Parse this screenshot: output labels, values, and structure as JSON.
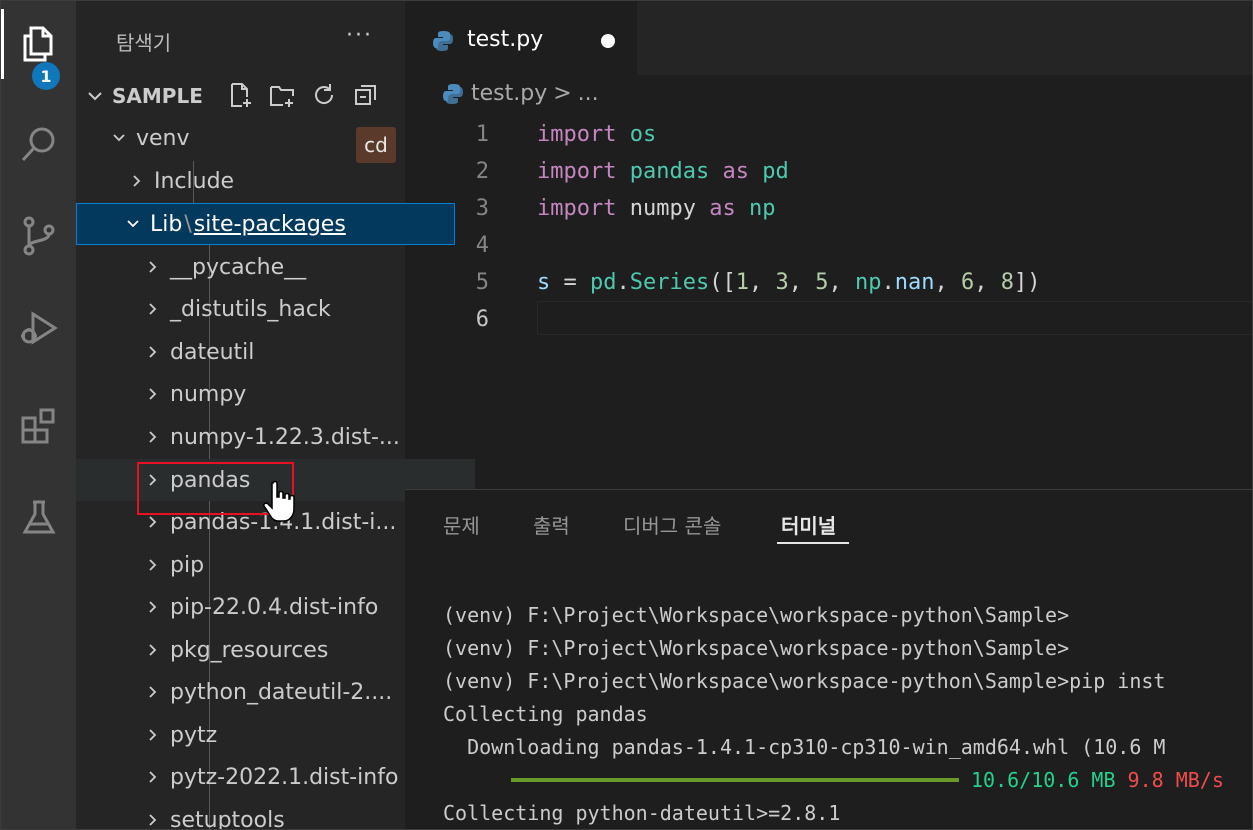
{
  "activity_bar": {
    "explorer_badge": "1",
    "icons": [
      "files-icon",
      "search-icon",
      "source-control-icon",
      "run-debug-icon",
      "extensions-icon",
      "testing-icon"
    ]
  },
  "sidebar": {
    "title": "탐색기",
    "more_label": "···",
    "section_label": "SAMPLE",
    "cd_badge": "cd",
    "tree": [
      {
        "label": "venv",
        "expanded": true
      },
      {
        "label": "Include",
        "expanded": false
      },
      {
        "label_a": "Lib",
        "separator": "\\",
        "label_b": "site-packages",
        "expanded": true
      },
      {
        "label": "__pycache__"
      },
      {
        "label": "_distutils_hack"
      },
      {
        "label": "dateutil"
      },
      {
        "label": "numpy"
      },
      {
        "label": "numpy-1.22.3.dist-..."
      },
      {
        "label": "pandas"
      },
      {
        "label": "pandas-1.4.1.dist-i..."
      },
      {
        "label": "pip"
      },
      {
        "label": "pip-22.0.4.dist-info"
      },
      {
        "label": "pkg_resources"
      },
      {
        "label": "python_dateutil-2...."
      },
      {
        "label": "pytz"
      },
      {
        "label": "pytz-2022.1.dist-info"
      },
      {
        "label": "setuptools"
      }
    ]
  },
  "editor": {
    "tab_label": "test.py",
    "breadcrumb_file": "test.py",
    "breadcrumb_sep": ">",
    "breadcrumb_more": "...",
    "line_numbers": [
      "1",
      "2",
      "3",
      "4",
      "5",
      "6"
    ],
    "code": {
      "l1_kw": "import",
      "l1_mod": "os",
      "l2_kw": "import",
      "l2_mod": "pandas",
      "l2_as": "as",
      "l2_alias": "pd",
      "l3_kw": "import",
      "l3_mod": "numpy",
      "l3_as": "as",
      "l3_alias": "np",
      "l5_var": "s",
      "l5_eq": " = ",
      "l5_obj": "pd",
      "l5_dot": ".",
      "l5_cls": "Series",
      "l5_open": "([",
      "l5_n1": "1",
      "l5_c1": ", ",
      "l5_n2": "3",
      "l5_c2": ", ",
      "l5_n3": "5",
      "l5_c3": ", ",
      "l5_np": "np",
      "l5_dot2": ".",
      "l5_nan": "nan",
      "l5_c4": ", ",
      "l5_n4": "6",
      "l5_c5": ", ",
      "l5_n5": "8",
      "l5_close": "])"
    }
  },
  "panel": {
    "tabs": [
      "문제",
      "출력",
      "디버그 콘솔",
      "터미널"
    ],
    "active_tab": "터미널",
    "terminal": {
      "line1": "(venv) F:\\Project\\Workspace\\workspace-python\\Sample>",
      "line2": "(venv) F:\\Project\\Workspace\\workspace-python\\Sample>",
      "line3": "(venv) F:\\Project\\Workspace\\workspace-python\\Sample>pip inst",
      "line4": "Collecting pandas",
      "line5": "  Downloading pandas-1.4.1-cp310-cp310-win_amd64.whl (10.6 M",
      "progress_size": "10.6/10.6 MB",
      "progress_speed": "9.8 MB/s",
      "progress_fraction": 1.0,
      "line7": "Collecting python-dateutil>=2.8.1"
    }
  },
  "colors": {
    "accent": "#007fd4",
    "highlight_box": "#e81123",
    "progress": "#6a9a2a"
  }
}
